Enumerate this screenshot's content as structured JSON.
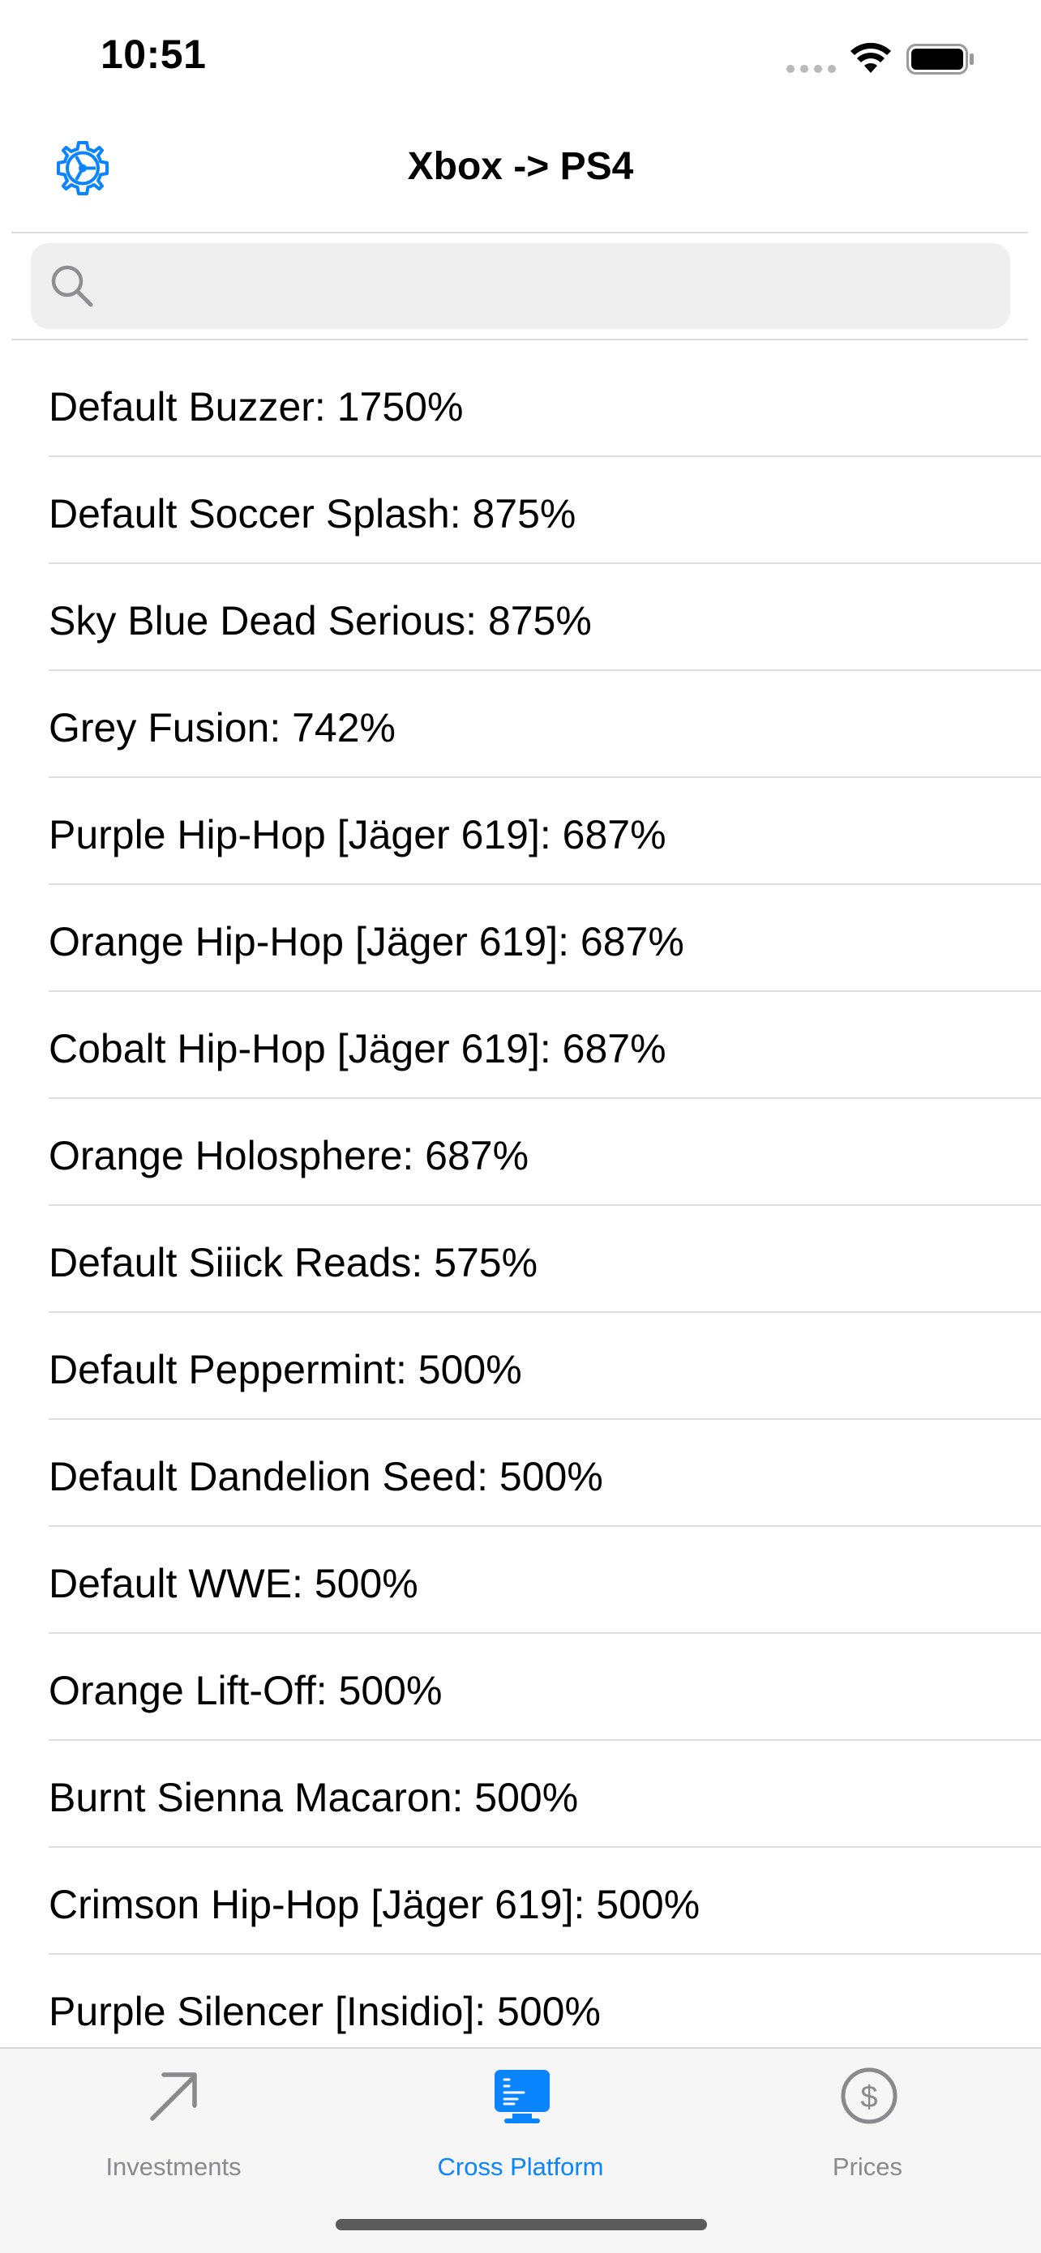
{
  "status_bar": {
    "time": "10:51"
  },
  "nav": {
    "title": "Xbox -> PS4",
    "settings_icon": "gear-icon"
  },
  "search": {
    "placeholder": "",
    "value": ""
  },
  "items": [
    {
      "label": "Default Buzzer: 1750%"
    },
    {
      "label": "Default Soccer Splash: 875%"
    },
    {
      "label": "Sky Blue Dead Serious: 875%"
    },
    {
      "label": "Grey Fusion: 742%"
    },
    {
      "label": "Purple Hip-Hop [Jäger 619]: 687%"
    },
    {
      "label": "Orange Hip-Hop [Jäger 619]: 687%"
    },
    {
      "label": "Cobalt Hip-Hop [Jäger 619]: 687%"
    },
    {
      "label": "Orange Holosphere: 687%"
    },
    {
      "label": "Default Siiick Reads: 575%"
    },
    {
      "label": "Default Peppermint: 500%"
    },
    {
      "label": "Default Dandelion Seed: 500%"
    },
    {
      "label": "Default WWE: 500%"
    },
    {
      "label": "Orange Lift-Off: 500%"
    },
    {
      "label": "Burnt Sienna Macaron: 500%"
    },
    {
      "label": "Crimson Hip-Hop [Jäger 619]: 500%"
    },
    {
      "label": "Purple Silencer [Insidio]: 500%"
    }
  ],
  "tabs": [
    {
      "label": "Investments",
      "icon": "arrow-up-right-icon",
      "active": false
    },
    {
      "label": "Cross Platform",
      "icon": "desktop-computer-icon",
      "active": true
    },
    {
      "label": "Prices",
      "icon": "dollar-circle-icon",
      "active": false
    }
  ],
  "colors": {
    "accent": "#0a84ff",
    "inactive_tab": "#8a8a8e"
  }
}
